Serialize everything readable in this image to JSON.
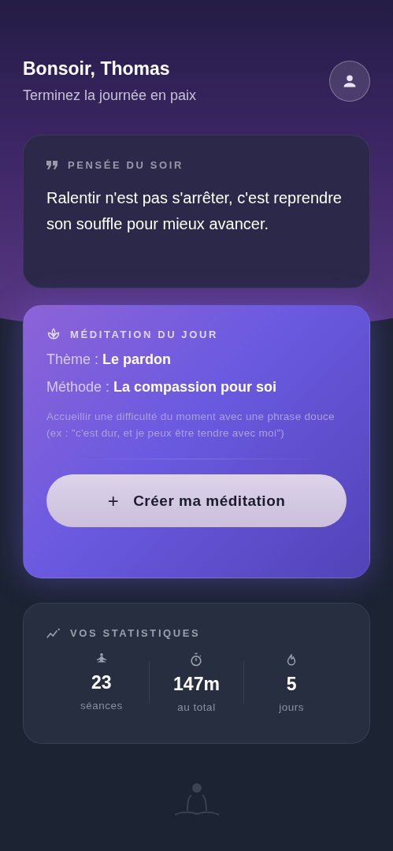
{
  "header": {
    "greeting": "Bonsoir, Thomas",
    "subtitle": "Terminez la journée en paix"
  },
  "thought": {
    "label": "PENSÉE DU SOIR",
    "quote": "Ralentir n'est pas s'arrêter, c'est reprendre son souffle pour mieux avancer."
  },
  "meditation": {
    "label": "MÉDITATION DU JOUR",
    "fields": [
      {
        "name": "Thème :",
        "value": "Le pardon"
      },
      {
        "name": "Méthode :",
        "value": "La compassion pour soi"
      }
    ],
    "description": "Accueillir une difficulté du moment avec une phrase douce (ex : \"c'est dur, et je peux être tendre avec moi\")",
    "button": {
      "icon": "+",
      "label": "Créer ma méditation"
    }
  },
  "stats": {
    "label": "VOS STATISTIQUES",
    "items": [
      {
        "kind": "sessions",
        "value": "23",
        "caption": "séances"
      },
      {
        "kind": "time",
        "value": "147m",
        "caption": "au total"
      },
      {
        "kind": "streak",
        "value": "5",
        "caption": "jours"
      }
    ]
  }
}
